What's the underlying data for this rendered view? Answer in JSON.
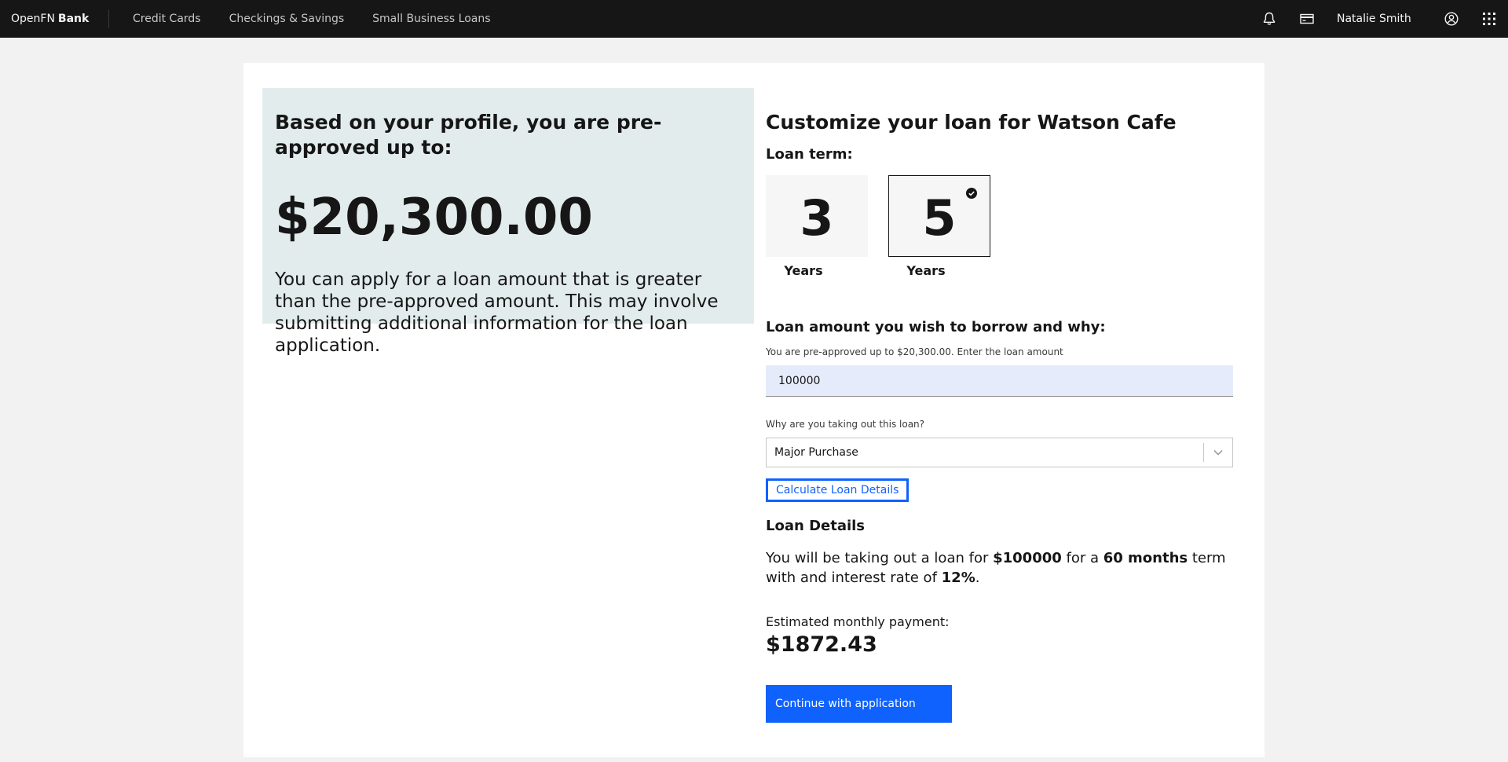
{
  "header": {
    "brand_prefix": "OpenFN",
    "brand_name": "Bank",
    "nav": [
      "Credit Cards",
      "Checkings & Savings",
      "Small Business Loans"
    ],
    "user_name": "Natalie Smith",
    "icons": [
      "bell-icon",
      "card-icon",
      "user-avatar-icon",
      "app-switcher-icon"
    ]
  },
  "promo": {
    "heading": "Based on your profile, you are pre-approved up to:",
    "amount": "$20,300.00",
    "note": "You can apply for a loan amount that is greater than the pre-approved amount. This may involve submitting additional information for the loan application."
  },
  "customize": {
    "title": "Customize your loan for Watson Cafe",
    "term_label": "Loan term:",
    "terms": [
      {
        "value": "3",
        "unit": "Years",
        "selected": false
      },
      {
        "value": "5",
        "unit": "Years",
        "selected": true
      }
    ],
    "amount_heading": "Loan amount you wish to borrow and why:",
    "amount_helper": "You are pre-approved up to $20,300.00. Enter the loan amount",
    "amount_value": "100000",
    "reason_label": "Why are you taking out this loan?",
    "reason_value": "Major Purchase",
    "calculate_label": "Calculate Loan Details"
  },
  "details": {
    "heading": "Loan Details",
    "t1": "You will be taking out a loan for ",
    "amount": "$100000",
    "t2": " for a ",
    "term": "60 months",
    "t3": " term with and interest rate of ",
    "rate": "12%",
    "t4": ".",
    "est_label": "Estimated monthly payment:",
    "est_amount": "$1872.43"
  },
  "continue_label": "Continue with application",
  "colors": {
    "header_bg": "#161616",
    "accent": "#0f62fe",
    "promo_bg": "#e3ecec",
    "page_bg": "#f2f2f2"
  }
}
